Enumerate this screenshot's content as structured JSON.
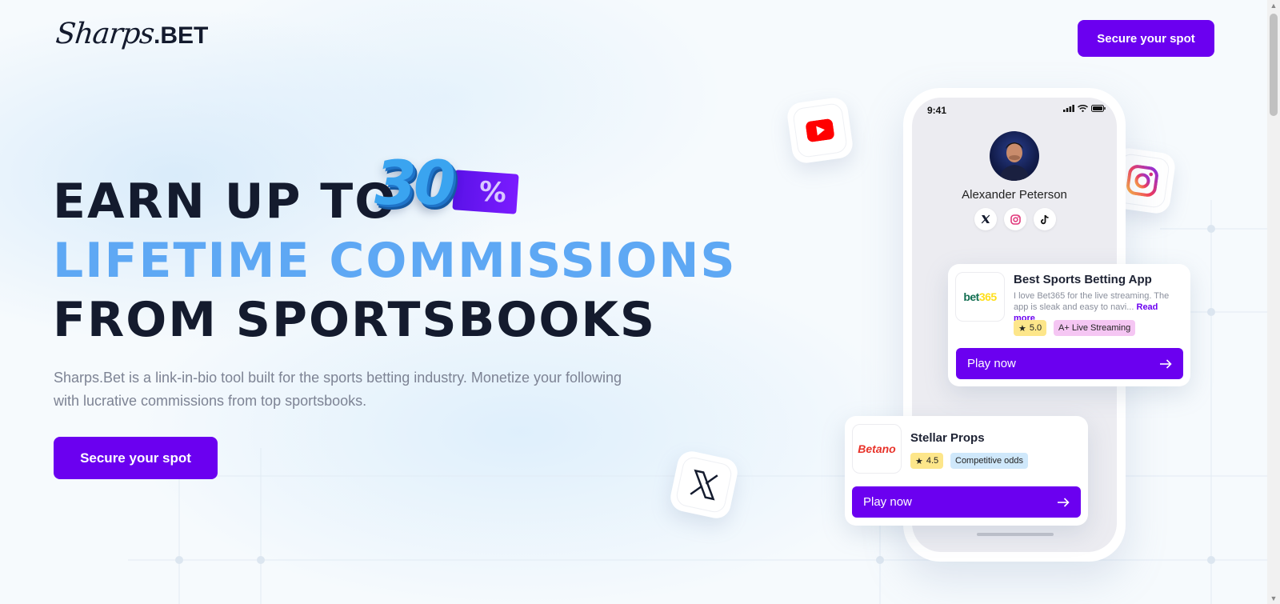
{
  "brand": {
    "logo_script": "Sharps",
    "logo_suffix": ".BET"
  },
  "nav": {
    "cta_label": "Secure your spot"
  },
  "hero": {
    "headline_line1": "EARN UP TO",
    "badge_value": "30",
    "badge_unit": "%",
    "headline_line2": "LIFETIME COMMISSIONS",
    "headline_line3": "FROM SPORTSBOOKS",
    "subtext": "Sharps.Bet is a link-in-bio tool built for the sports betting industry. Monetize your following with lucrative commissions from top sportsbooks.",
    "cta_label": "Secure your spot"
  },
  "phone": {
    "time": "9:41",
    "profile_name": "Alexander Peterson",
    "social_icons": [
      "x-icon",
      "instagram-icon",
      "tiktok-icon"
    ]
  },
  "cards": [
    {
      "brand": "bet365",
      "title": "Best Sports Betting App",
      "review": "I love Bet365 for the live streaming. The app is sleak and easy to navi...",
      "read_more": "Read more",
      "rating": "5.0",
      "tag": "A+ Live Streaming",
      "cta": "Play now"
    },
    {
      "brand": "Betano",
      "title": "Stellar Props",
      "rating": "4.5",
      "tag": "Competitive odds",
      "cta": "Play now"
    }
  ],
  "floating_icons": [
    "youtube-icon",
    "instagram-icon",
    "x-icon"
  ],
  "colors": {
    "primary": "#6b00f0",
    "accent_blue": "#5ea8f4",
    "text_dark": "#141b2e",
    "rating_chip": "#fde68a",
    "tag_pink": "#f5c6f3",
    "tag_blue": "#cfe8fb"
  }
}
